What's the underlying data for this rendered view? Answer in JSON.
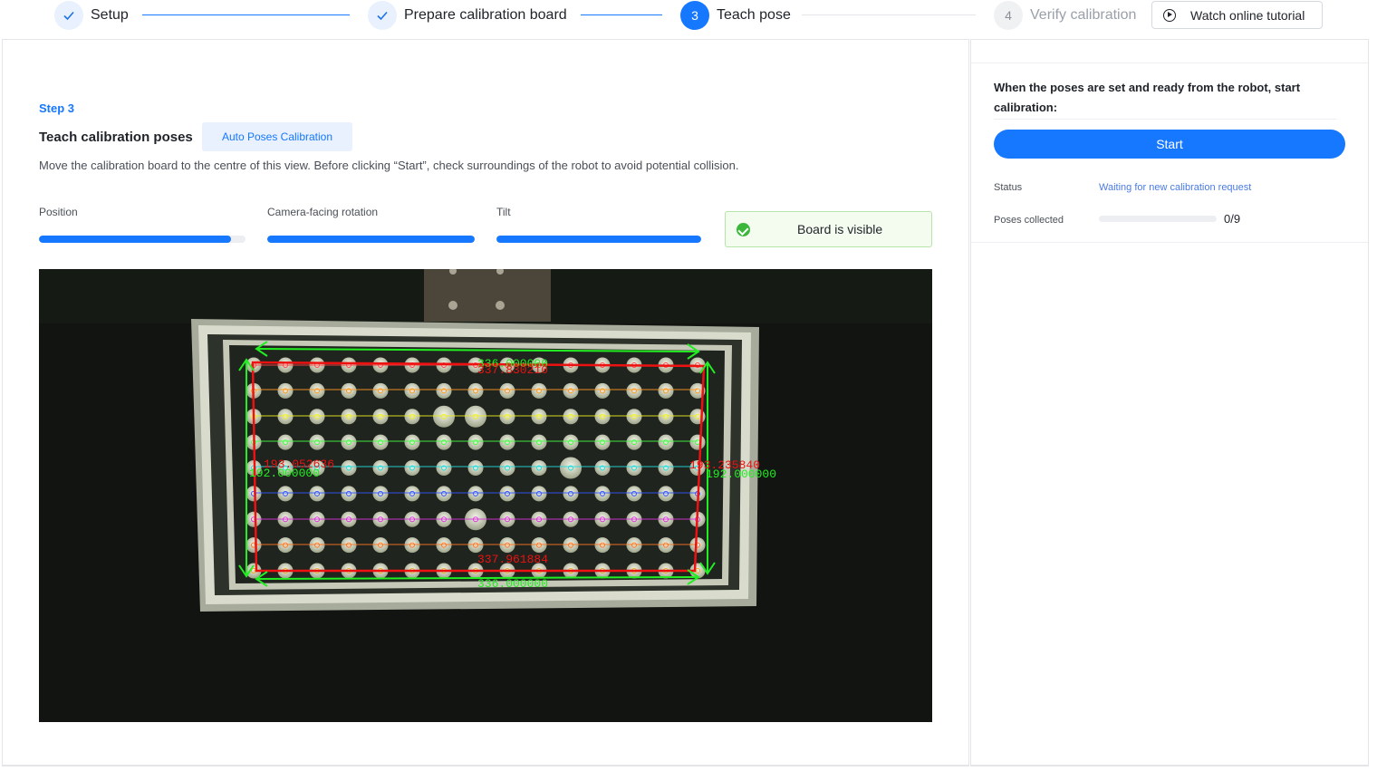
{
  "stepper": {
    "steps": [
      {
        "number": "",
        "label": "Setup",
        "state": "done"
      },
      {
        "number": "",
        "label": "Prepare calibration board",
        "state": "done"
      },
      {
        "number": "3",
        "label": "Teach pose",
        "state": "active"
      },
      {
        "number": "4",
        "label": "Verify calibration",
        "state": "pending"
      }
    ],
    "tutorial_label": "Watch online tutorial"
  },
  "main": {
    "step_tag": "Step 3",
    "title": "Teach calibration poses",
    "auto_button": "Auto Poses Calibration",
    "instruction": "Move the calibration board to the centre of this view. Before clicking “Start”, check surroundings of the robot to avoid potential collision.",
    "metrics": [
      {
        "label": "Position",
        "value": 0.93
      },
      {
        "label": "Camera-facing rotation",
        "value": 1.0
      },
      {
        "label": "Tilt",
        "value": 1.0
      }
    ],
    "board_status": "Board is visible",
    "camera_overlay": {
      "top_measure_green": "336.000000",
      "top_measure_red": "337.830210",
      "left_measure_red": "193.052636",
      "left_measure_green": "192.000000",
      "right_measure_red": "193.235840",
      "right_measure_green": "192.000000",
      "bottom_measure_red": "337.961884",
      "bottom_measure_green": "336.000000"
    }
  },
  "side": {
    "question": "When the poses are set and ready from the robot, start calibration:",
    "start_label": "Start",
    "status_label": "Status",
    "status_value": "Waiting for new calibration request",
    "poses_label": "Poses collected",
    "poses_value": "0/9",
    "poses_progress": 0
  },
  "colors": {
    "accent": "#1677ff",
    "success": "#3bb83b",
    "overlay_green": "#22ee22",
    "overlay_red": "#ee1111"
  }
}
